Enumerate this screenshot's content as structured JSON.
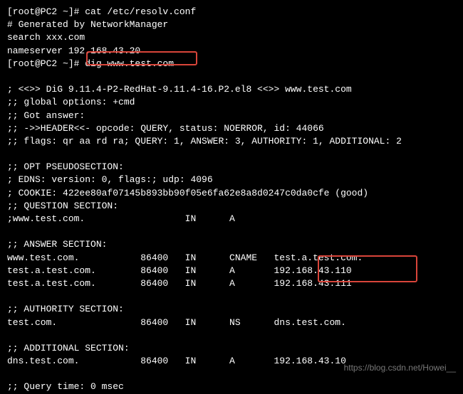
{
  "lines": {
    "l1": "[root@PC2 ~]# cat /etc/resolv.conf",
    "l2": "# Generated by NetworkManager",
    "l3": "search xxx.com",
    "l4": "nameserver 192.168.43.20",
    "l5": "[root@PC2 ~]# dig www.test.com",
    "l6": "",
    "l7": "; <<>> DiG 9.11.4-P2-RedHat-9.11.4-16.P2.el8 <<>> www.test.com",
    "l8": ";; global options: +cmd",
    "l9": ";; Got answer:",
    "l10": ";; ->>HEADER<<- opcode: QUERY, status: NOERROR, id: 44066",
    "l11": ";; flags: qr aa rd ra; QUERY: 1, ANSWER: 3, AUTHORITY: 1, ADDITIONAL: 2",
    "l12": "",
    "l13": ";; OPT PSEUDOSECTION:",
    "l14": "; EDNS: version: 0, flags:; udp: 4096",
    "l15": "; COOKIE: 422ee80af07145b893bb90f05e6fa62e8a8d0247c0da0cfe (good)",
    "l16": ";; QUESTION SECTION:",
    "l17": ";www.test.com.                  IN      A",
    "l18": "",
    "l19": ";; ANSWER SECTION:",
    "l20": "www.test.com.           86400   IN      CNAME   test.a.test.com.",
    "l21": "test.a.test.com.        86400   IN      A       192.168.43.110",
    "l22": "test.a.test.com.        86400   IN      A       192.168.43.111",
    "l23": "",
    "l24": ";; AUTHORITY SECTION:",
    "l25": "test.com.               86400   IN      NS      dns.test.com.",
    "l26": "",
    "l27": ";; ADDITIONAL SECTION:",
    "l28": "dns.test.com.           86400   IN      A       192.168.43.10",
    "l29": "",
    "l30": ";; Query time: 0 msec"
  },
  "watermark": "https://blog.csdn.net/Howei__"
}
